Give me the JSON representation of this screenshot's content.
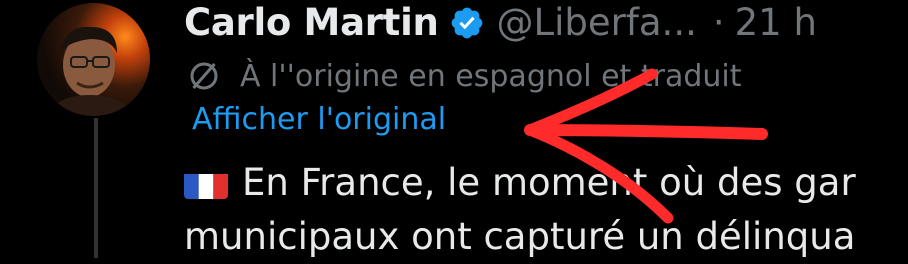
{
  "tweet": {
    "author_name": "Carlo Martin",
    "handle": "@Liberfa...",
    "dot": "·",
    "time": "21 h",
    "translation_note": "À l''origine en espagnol et traduit",
    "show_original_label": "Afficher l'original",
    "text_line_1": "En France, le moment où des gar",
    "text_line_2": "municipaux ont capturé un délinqua"
  },
  "icons": {
    "avatar": "profile-photo",
    "verified": "verified-badge-icon",
    "translate": "translate-icon",
    "flag": "france-flag-icon"
  },
  "colors": {
    "background": "#000000",
    "primary_text": "#e7e9ea",
    "secondary_text": "#71767b",
    "link": "#1d9bf0",
    "verified": "#1d9bf0",
    "annotation_arrow": "#ff2a2a"
  }
}
